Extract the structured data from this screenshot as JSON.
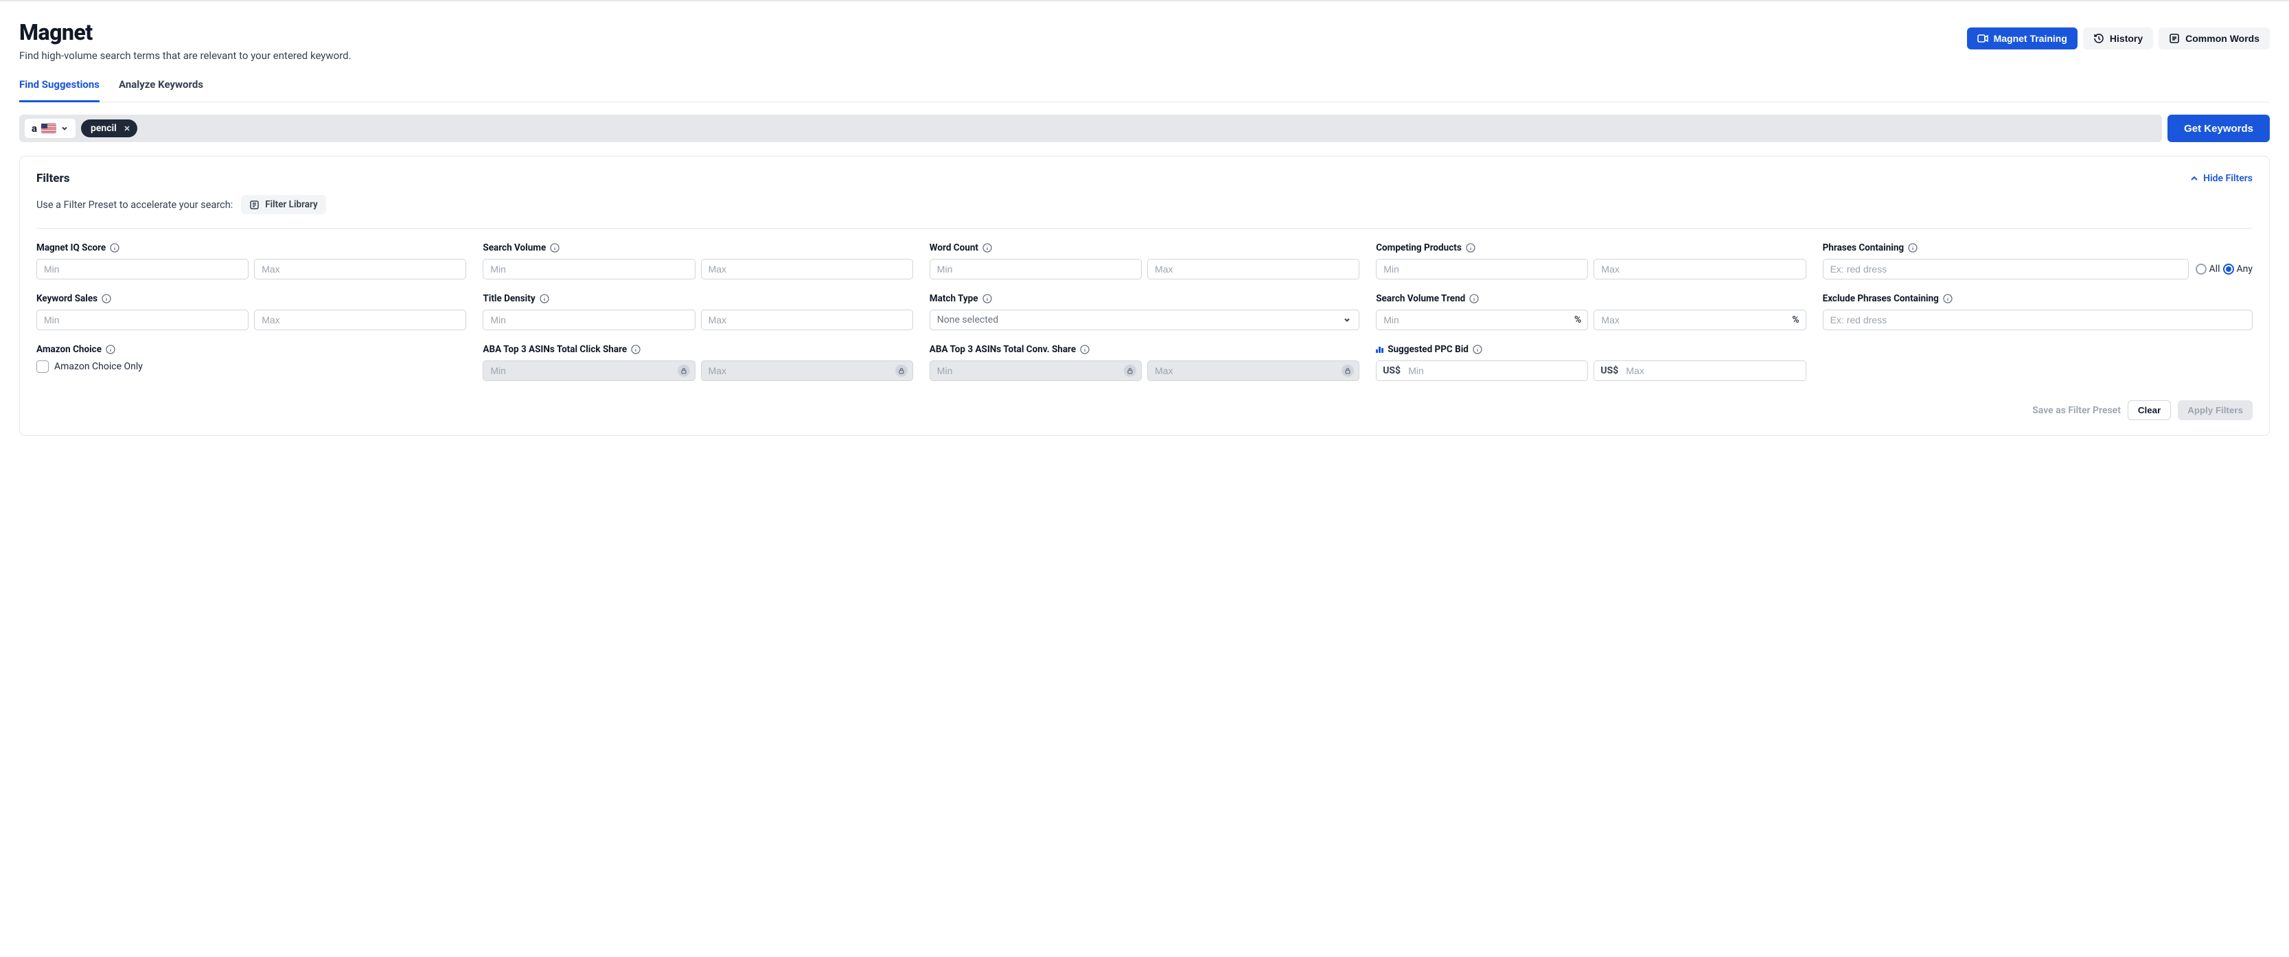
{
  "header": {
    "title": "Magnet",
    "subtitle": "Find high-volume search terms that are relevant to your entered keyword.",
    "buttons": {
      "training": "Magnet Training",
      "history": "History",
      "common_words": "Common Words"
    }
  },
  "tabs": {
    "find_suggestions": "Find Suggestions",
    "analyze_keywords": "Analyze Keywords"
  },
  "search": {
    "marketplace_logo": "a",
    "chip": "pencil",
    "get_keywords": "Get Keywords"
  },
  "filters_panel": {
    "title": "Filters",
    "hide": "Hide Filters",
    "preset_label": "Use a Filter Preset to accelerate your search:",
    "filter_library": "Filter Library"
  },
  "filters": {
    "magnet_iq": {
      "label": "Magnet IQ Score",
      "min_ph": "Min",
      "max_ph": "Max"
    },
    "search_volume": {
      "label": "Search Volume",
      "min_ph": "Min",
      "max_ph": "Max"
    },
    "word_count": {
      "label": "Word Count",
      "min_ph": "Min",
      "max_ph": "Max"
    },
    "competing_products": {
      "label": "Competing Products",
      "min_ph": "Min",
      "max_ph": "Max"
    },
    "phrases_containing": {
      "label": "Phrases Containing",
      "ph": "Ex: red dress",
      "all": "All",
      "any": "Any"
    },
    "keyword_sales": {
      "label": "Keyword Sales",
      "min_ph": "Min",
      "max_ph": "Max"
    },
    "title_density": {
      "label": "Title Density",
      "min_ph": "Min",
      "max_ph": "Max"
    },
    "match_type": {
      "label": "Match Type",
      "selected": "None selected"
    },
    "sv_trend": {
      "label": "Search Volume Trend",
      "min_ph": "Min",
      "max_ph": "Max",
      "suffix": "%"
    },
    "exclude_phrases": {
      "label": "Exclude Phrases Containing",
      "ph": "Ex: red dress"
    },
    "amazon_choice": {
      "label": "Amazon Choice",
      "checkbox": "Amazon Choice Only"
    },
    "aba_click": {
      "label": "ABA Top 3 ASINs Total Click Share",
      "min_ph": "Min",
      "max_ph": "Max"
    },
    "aba_conv": {
      "label": "ABA Top 3 ASINs Total Conv. Share",
      "min_ph": "Min",
      "max_ph": "Max"
    },
    "ppc_bid": {
      "label": "Suggested PPC Bid",
      "prefix": "US$",
      "min_ph": "Min",
      "max_ph": "Max"
    }
  },
  "footer": {
    "save_preset": "Save as Filter Preset",
    "clear": "Clear",
    "apply": "Apply Filters"
  }
}
